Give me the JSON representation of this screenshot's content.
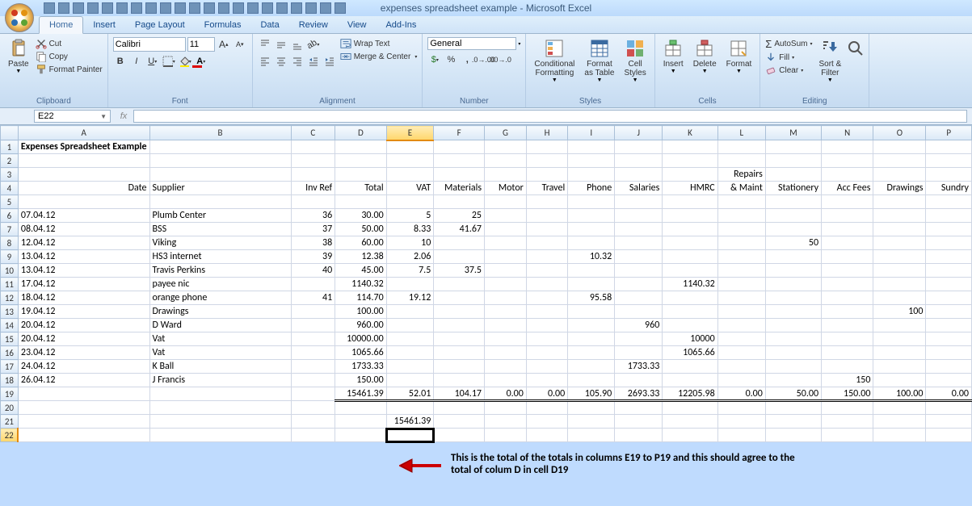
{
  "window": {
    "title": "expenses spreadsheet example - Microsoft Excel"
  },
  "tabs": [
    "Home",
    "Insert",
    "Page Layout",
    "Formulas",
    "Data",
    "Review",
    "View",
    "Add-Ins"
  ],
  "active_tab": 0,
  "ribbon": {
    "clipboard": {
      "label": "Clipboard",
      "paste": "Paste",
      "cut": "Cut",
      "copy": "Copy",
      "format_painter": "Format Painter"
    },
    "font": {
      "label": "Font",
      "name": "Calibri",
      "size": "11"
    },
    "alignment": {
      "label": "Alignment",
      "wrap": "Wrap Text",
      "merge": "Merge & Center"
    },
    "number": {
      "label": "Number",
      "format": "General"
    },
    "styles": {
      "label": "Styles",
      "cond": "Conditional\nFormatting",
      "table": "Format\nas Table",
      "cell": "Cell\nStyles"
    },
    "cells": {
      "label": "Cells",
      "insert": "Insert",
      "delete": "Delete",
      "format": "Format"
    },
    "editing": {
      "label": "Editing",
      "autosum": "AutoSum",
      "fill": "Fill",
      "clear": "Clear",
      "sort": "Sort &\nFilter",
      "find": "F"
    }
  },
  "name_box": "E22",
  "formula": "",
  "columns": [
    "A",
    "B",
    "C",
    "D",
    "E",
    "F",
    "G",
    "H",
    "I",
    "J",
    "K",
    "L",
    "M",
    "N",
    "O",
    "P"
  ],
  "active_cell": {
    "col": "E",
    "row": 22
  },
  "chart_data": {
    "type": "table",
    "title": "Expenses Spreadsheet Example",
    "headers": {
      "row3": {
        "L": "Repairs"
      },
      "row4": {
        "A": "Date",
        "B": "Supplier",
        "C": "Inv Ref",
        "D": "Total",
        "E": "VAT",
        "F": "Materials",
        "G": "Motor",
        "H": "Travel",
        "I": "Phone",
        "J": "Salaries",
        "K": "HMRC",
        "L": "& Maint",
        "M": "Stationery",
        "N": "Acc Fees",
        "O": "Drawings",
        "P": "Sundry"
      }
    },
    "rows": [
      {
        "n": 6,
        "A": "07.04.12",
        "B": "Plumb Center",
        "C": "36",
        "D": "30.00",
        "E": "5",
        "F": "25"
      },
      {
        "n": 7,
        "A": "08.04.12",
        "B": "BSS",
        "C": "37",
        "D": "50.00",
        "E": "8.33",
        "F": "41.67"
      },
      {
        "n": 8,
        "A": "12.04.12",
        "B": "Viking",
        "C": "38",
        "D": "60.00",
        "E": "10",
        "M": "50"
      },
      {
        "n": 9,
        "A": "13.04.12",
        "B": "HS3 internet",
        "C": "39",
        "D": "12.38",
        "E": "2.06",
        "I": "10.32"
      },
      {
        "n": 10,
        "A": "13.04.12",
        "B": "Travis Perkins",
        "C": "40",
        "D": "45.00",
        "E": "7.5",
        "F": "37.5"
      },
      {
        "n": 11,
        "A": "17.04.12",
        "B": "payee nic",
        "D": "1140.32",
        "K": "1140.32"
      },
      {
        "n": 12,
        "A": "18.04.12",
        "B": "orange phone",
        "C": "41",
        "D": "114.70",
        "E": "19.12",
        "I": "95.58"
      },
      {
        "n": 13,
        "A": "19.04.12",
        "B": "Drawings",
        "D": "100.00",
        "O": "100"
      },
      {
        "n": 14,
        "A": "20.04.12",
        "B": "D Ward",
        "D": "960.00",
        "J": "960"
      },
      {
        "n": 15,
        "A": "20.04.12",
        "B": "Vat",
        "D": "10000.00",
        "K": "10000"
      },
      {
        "n": 16,
        "A": "23.04.12",
        "B": "Vat",
        "D": "1065.66",
        "K": "1065.66"
      },
      {
        "n": 17,
        "A": "24.04.12",
        "B": "K Ball",
        "D": "1733.33",
        "J": "1733.33"
      },
      {
        "n": 18,
        "A": "26.04.12",
        "B": "J Francis",
        "D": "150.00",
        "N": "150"
      }
    ],
    "totals": {
      "n": 19,
      "D": "15461.39",
      "E": "52.01",
      "F": "104.17",
      "G": "0.00",
      "H": "0.00",
      "I": "105.90",
      "J": "2693.33",
      "K": "12205.98",
      "L": "0.00",
      "M": "50.00",
      "N": "150.00",
      "O": "100.00",
      "P": "0.00"
    },
    "grand_total_cell": {
      "n": 21,
      "E": "15461.39"
    }
  },
  "annotation": "This is the total of the totals in columns E19 to P19 and this should agree to the total of colum D in cell D19"
}
